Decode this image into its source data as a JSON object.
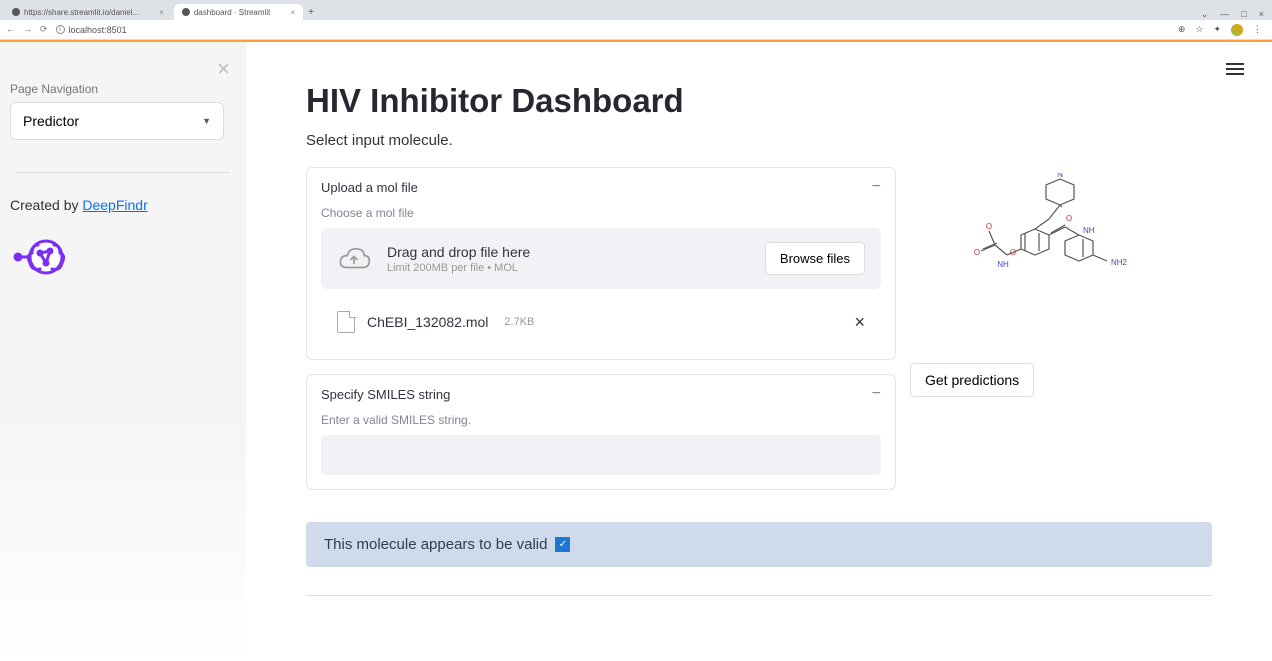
{
  "browser": {
    "tabs": [
      {
        "title": "https://share.streamlit.io/daniel..."
      },
      {
        "title": "dashboard · Streamlit"
      }
    ],
    "addr": "localhost:8501"
  },
  "sidebar": {
    "nav_label": "Page Navigation",
    "nav_selected": "Predictor",
    "created_prefix": "Created by ",
    "created_link": "DeepFindr"
  },
  "page": {
    "title": "HIV Inhibitor Dashboard",
    "subtitle": "Select input molecule."
  },
  "panels": {
    "upload": {
      "title": "Upload a mol file",
      "choose_label": "Choose a mol file",
      "dz_main": "Drag and drop file here",
      "dz_sub": "Limit 200MB per file • MOL",
      "browse": "Browse files",
      "file_name": "ChEBI_132082.mol",
      "file_size": "2.7KB"
    },
    "smiles": {
      "title": "Specify SMILES string",
      "label": "Enter a valid SMILES string.",
      "value": ""
    }
  },
  "right": {
    "predict_btn": "Get predictions",
    "mol_labels": {
      "n": "N",
      "o1": "O",
      "o2": "O",
      "o3": "O",
      "o4": "O",
      "nh1": "NH",
      "nh2": "NH",
      "nh2_term": "NH2"
    }
  },
  "banner": {
    "text": "This molecule appears to be valid"
  }
}
